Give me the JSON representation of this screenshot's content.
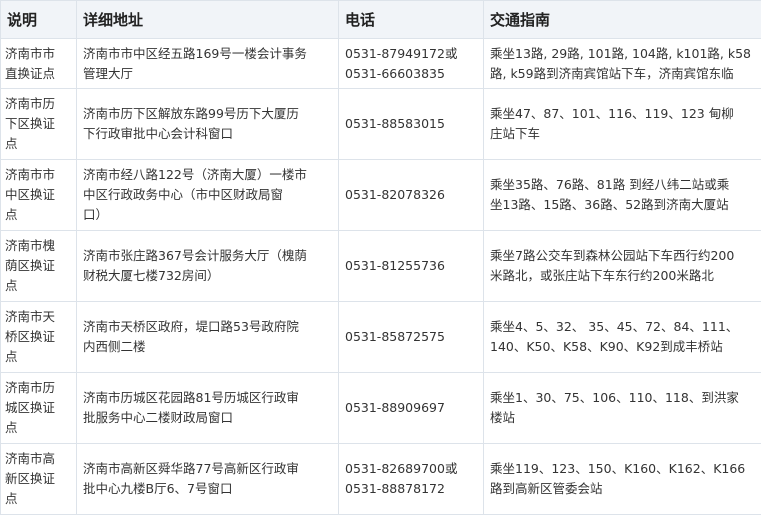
{
  "headers": [
    "说明",
    "详细地址",
    "电话",
    "交通指南"
  ],
  "rows": [
    {
      "desc": "济南市市\n直换证点",
      "address": "济南市市中区经五路169号一楼会计事务\n管理大厅",
      "phone": "0531-87949172或\n0531-66603835",
      "transit": "乘坐13路, 29路, 101路, 104路, k101路, k58\n路, k59路到济南宾馆站下车，济南宾馆东临"
    },
    {
      "desc": "济南市历\n下区换证\n点",
      "address": "济南市历下区解放东路99号历下大厦历\n下行政审批中心会计科窗口",
      "phone": "0531-88583015",
      "transit": "乘坐47、87、101、116、119、123 甸柳\n庄站下车"
    },
    {
      "desc": "济南市市\n中区换证\n点",
      "address": "济南市经八路122号（济南大厦）一楼市\n中区行政政务中心（市中区财政局窗\n口）",
      "phone": "0531-82078326",
      "transit": "乘坐35路、76路、81路 到经八纬二站或乘\n坐13路、15路、36路、52路到济南大厦站"
    },
    {
      "desc": "济南市槐\n荫区换证\n点",
      "address": "济南市张庄路367号会计服务大厅（槐荫\n财税大厦七楼732房间）",
      "phone": "0531-81255736",
      "transit": "乘坐7路公交车到森林公园站下车西行约200\n米路北，或张庄站下车东行约200米路北"
    },
    {
      "desc": "济南市天\n桥区换证\n点",
      "address": "济南市天桥区政府，堤口路53号政府院\n内西侧二楼",
      "phone": "0531-85872575",
      "transit": "乘坐4、5、32、 35、45、72、84、111、\n140、K50、K58、K90、K92到成丰桥站"
    },
    {
      "desc": "济南市历\n城区换证\n点",
      "address": "济南市历城区花园路81号历城区行政审\n批服务中心二楼财政局窗口",
      "phone": "0531-88909697",
      "transit": "乘坐1、30、75、106、110、118、到洪家\n楼站"
    },
    {
      "desc": "济南市高\n新区换证\n点",
      "address": "济南市高新区舜华路77号高新区行政审\n批中心九楼B厅6、7号窗口",
      "phone": "0531-82689700或\n0531-88878172",
      "transit": "乘坐119、123、150、K160、K162、K166\n路到高新区管委会站"
    }
  ]
}
